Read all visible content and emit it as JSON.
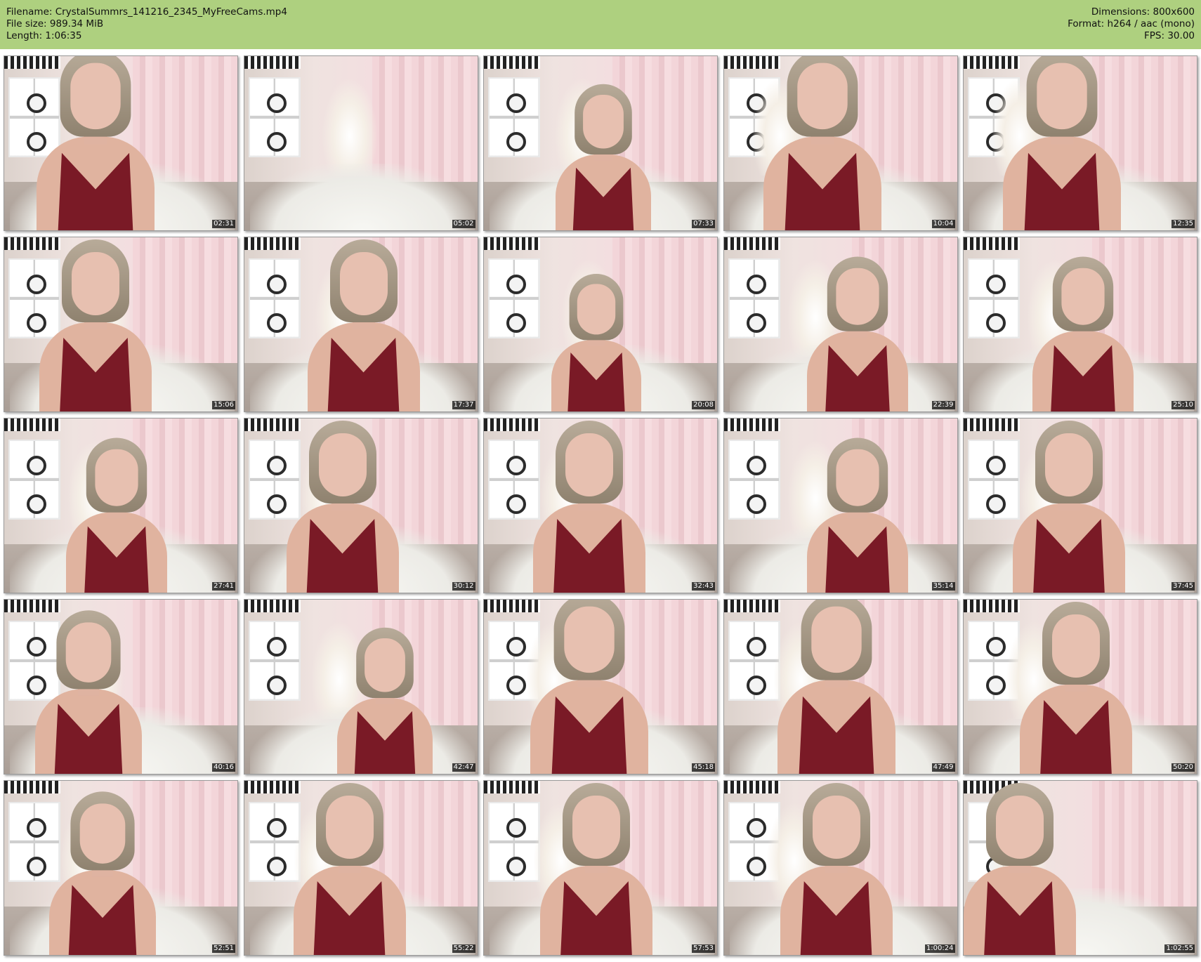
{
  "header": {
    "filename": "Filename: CrystalSummrs_141216_2345_MyFreeCams.mp4",
    "filesize": "File size: 989.34 MiB",
    "length": "Length: 1:06:35",
    "dimensions": "Dimensions: 800x600",
    "format": "Format: h264 / aac (mono)",
    "fps": "FPS: 30.00"
  },
  "colors": {
    "header_bg": "#aed07f",
    "garment": "#7a1a26"
  },
  "thumbnails": [
    {
      "time": "02:31"
    },
    {
      "time": "05:02"
    },
    {
      "time": "07:33"
    },
    {
      "time": "10:04"
    },
    {
      "time": "12:35"
    },
    {
      "time": "15:06"
    },
    {
      "time": "17:37"
    },
    {
      "time": "20:08"
    },
    {
      "time": "22:39"
    },
    {
      "time": "25:10"
    },
    {
      "time": "27:41"
    },
    {
      "time": "30:12"
    },
    {
      "time": "32:43"
    },
    {
      "time": "35:14"
    },
    {
      "time": "37:45"
    },
    {
      "time": "40:16"
    },
    {
      "time": "42:47"
    },
    {
      "time": "45:18"
    },
    {
      "time": "47:49"
    },
    {
      "time": "50:20"
    },
    {
      "time": "52:51"
    },
    {
      "time": "55:22"
    },
    {
      "time": "57:53"
    },
    {
      "time": "1:00:24"
    },
    {
      "time": "1:02:55"
    }
  ]
}
